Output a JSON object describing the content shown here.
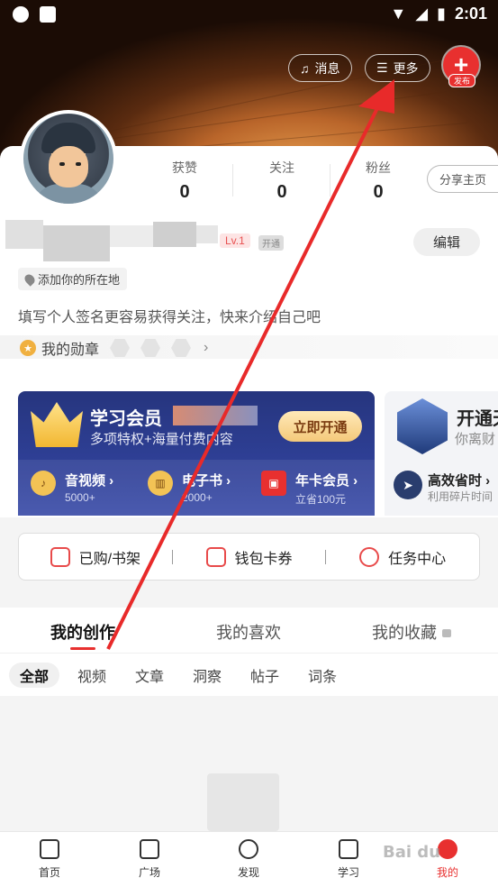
{
  "status_bar": {
    "time": "2:01"
  },
  "header": {
    "messages_label": "消息",
    "more_label": "更多",
    "publish_label": "发布"
  },
  "profile": {
    "stats": [
      {
        "label": "获赞",
        "value": "0"
      },
      {
        "label": "关注",
        "value": "0"
      },
      {
        "label": "粉丝",
        "value": "0"
      }
    ],
    "share_label": "分享主页",
    "level": "Lv.1",
    "vip_tag": "开通",
    "edit_label": "编辑",
    "location_label": "添加你的所在地",
    "bio_placeholder": "填写个人签名更容易获得关注，快来介绍自己吧",
    "medals_label": "我的勋章"
  },
  "membership": {
    "title": "学习会员",
    "subtitle": "多项特权+海量付费内容",
    "open_label": "立即开通",
    "perks": [
      {
        "title": "音视频",
        "sub": "5000+"
      },
      {
        "title": "电子书",
        "sub": "2000+"
      },
      {
        "title": "年卡会员",
        "sub": "立省100元"
      }
    ],
    "secondary": {
      "title": "开通天",
      "subtitle": "你离财",
      "perk_title": "高效省时",
      "perk_sub": "利用碎片时间"
    }
  },
  "quick_bar": [
    {
      "label": "已购/书架"
    },
    {
      "label": "钱包卡券"
    },
    {
      "label": "任务中心"
    }
  ],
  "tabs": [
    {
      "label": "我的创作",
      "active": true
    },
    {
      "label": "我的喜欢",
      "active": false
    },
    {
      "label": "我的收藏",
      "active": false,
      "locked": true
    }
  ],
  "filters": [
    "全部",
    "视频",
    "文章",
    "洞察",
    "帖子",
    "词条"
  ],
  "bottom_nav": [
    {
      "label": "首页",
      "icon": "home-icon"
    },
    {
      "label": "广场",
      "icon": "chat-icon"
    },
    {
      "label": "发现",
      "icon": "compass-icon"
    },
    {
      "label": "学习",
      "icon": "crown-icon"
    },
    {
      "label": "我的",
      "icon": "profile-icon",
      "active": true
    }
  ],
  "colors": {
    "accent": "#e8302f",
    "member_bg": "#2e3f95",
    "gold": "#f4c97a"
  }
}
